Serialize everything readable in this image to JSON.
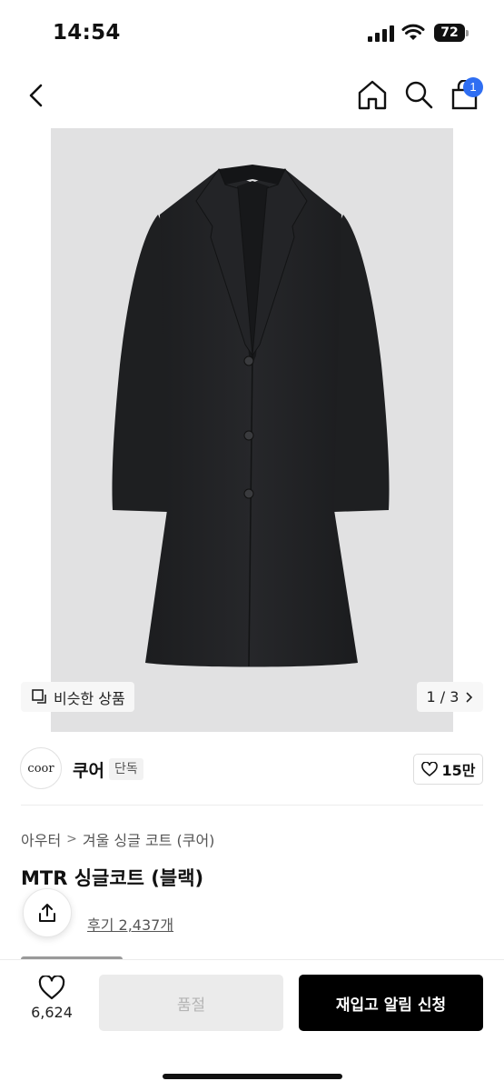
{
  "status_bar": {
    "time": "14:54",
    "battery": "72"
  },
  "header": {
    "cart_count": "1"
  },
  "gallery": {
    "similar_label": "비슷한 상품",
    "page_indicator": "1 / 3"
  },
  "brand": {
    "logo_text": "coor",
    "name": "쿠어",
    "tag": "단독",
    "likes": "15만"
  },
  "product": {
    "breadcrumb": [
      "아우터",
      "겨울 싱글 코트 (쿠어)"
    ],
    "title": "MTR 싱글코트 (블랙)",
    "reviews": "후기 2,437개"
  },
  "bottom_bar": {
    "wishlist_count": "6,624",
    "sold_out_label": "품절",
    "restock_label": "재입고 알림 신청"
  }
}
